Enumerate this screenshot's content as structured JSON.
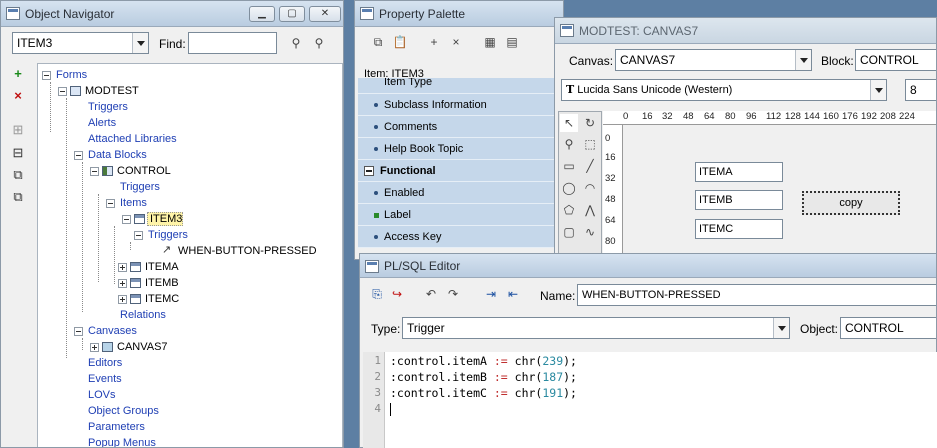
{
  "navigator": {
    "title": "Object Navigator",
    "dropdown_value": "ITEM3",
    "find_label": "Find:",
    "find_value": "",
    "tree": {
      "forms": "Forms",
      "modtest": "MODTEST",
      "triggers": "Triggers",
      "alerts": "Alerts",
      "attached_libraries": "Attached Libraries",
      "data_blocks": "Data Blocks",
      "control": "CONTROL",
      "control_triggers": "Triggers",
      "items": "Items",
      "item3": "ITEM3",
      "item3_triggers": "Triggers",
      "when_button_pressed": "WHEN-BUTTON-PRESSED",
      "itema": "ITEMA",
      "itemb": "ITEMB",
      "itemc": "ITEMC",
      "relations": "Relations",
      "canvases": "Canvases",
      "canvas7": "CANVAS7",
      "editors": "Editors",
      "events": "Events",
      "lovs": "LOVs",
      "object_groups": "Object Groups",
      "parameters": "Parameters",
      "popup_menus": "Popup Menus"
    }
  },
  "palette": {
    "title": "Property Palette",
    "item_label": "Item: ITEM3",
    "partial_row": "Item Type",
    "rows": [
      "Subclass Information",
      "Comments",
      "Help Book Topic"
    ],
    "section": "Functional",
    "functional_rows": [
      "Enabled",
      "Label",
      "Access Key"
    ]
  },
  "canvas": {
    "title": "MODTEST: CANVAS7",
    "canvas_label": "Canvas:",
    "canvas_value": "CANVAS7",
    "block_label": "Block:",
    "block_value": "CONTROL",
    "font_value": "Lucida Sans Unicode (Western)",
    "font_size": "8",
    "ruler_h": [
      "0",
      "16",
      "32",
      "48",
      "64",
      "80",
      "96",
      "112",
      "128",
      "144",
      "160",
      "176",
      "192",
      "208",
      "224"
    ],
    "ruler_v": [
      "0",
      "16",
      "32",
      "48",
      "64",
      "80"
    ],
    "items": [
      "ITEMA",
      "ITEMB",
      "ITEMC"
    ],
    "button_label": "copy"
  },
  "editor": {
    "title": "PL/SQL Editor",
    "name_label": "Name:",
    "name_value": "WHEN-BUTTON-PRESSED",
    "type_label": "Type:",
    "type_value": "Trigger",
    "object_label": "Object:",
    "object_value": "CONTROL",
    "lines": [
      {
        "n": "1",
        "lhs": ":control.itemA ",
        "op": ":=",
        "fn": " chr(",
        "num": "239",
        "end": ");"
      },
      {
        "n": "2",
        "lhs": ":control.itemB ",
        "op": ":=",
        "fn": " chr(",
        "num": "187",
        "end": ");"
      },
      {
        "n": "3",
        "lhs": ":control.itemC ",
        "op": ":=",
        "fn": " chr(",
        "num": "191",
        "end": ");"
      },
      {
        "n": "4",
        "lhs": "",
        "op": "",
        "fn": "",
        "num": "",
        "end": ""
      }
    ]
  },
  "icons": [
    "add-icon",
    "delete-icon",
    "expand-icon",
    "collapse-icon",
    "expand-all-icon",
    "collapse-all-icon",
    "search-icon",
    "cut-icon",
    "copy-icon",
    "paste-icon",
    "undo-icon",
    "redo-icon",
    "indent-icon",
    "outdent-icon",
    "compile-icon",
    "pointer-icon",
    "rotate-icon",
    "magnify-icon",
    "rectangle-icon",
    "line-icon",
    "ellipse-icon",
    "arc-icon",
    "polygon-icon",
    "freehand-icon",
    "rounded-rect-icon",
    "text-icon"
  ]
}
